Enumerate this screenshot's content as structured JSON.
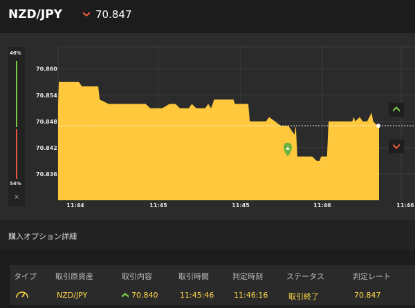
{
  "header": {
    "pair": "NZD/JPY",
    "rate": "70.847",
    "direction_icon": "down-arrow-icon",
    "direction_color": "#e2583e"
  },
  "ratio": {
    "high": "46%",
    "low": "54%",
    "close_label": "×",
    "high_color": "#7ac943",
    "low_color": "#e2583e"
  },
  "chart_data": {
    "type": "area",
    "color": "#ffc83d",
    "ylim": [
      70.83,
      70.865
    ],
    "y_ticks": [
      "70.860",
      "70.854",
      "70.848",
      "70.842",
      "70.836"
    ],
    "x_ticks": [
      "11:44",
      "11:45",
      "11:45",
      "11:46",
      "11:46"
    ],
    "current_rate": 70.847,
    "entry_rate": 70.84,
    "points": [
      [
        0,
        70.852
      ],
      [
        1,
        70.857
      ],
      [
        28,
        70.857
      ],
      [
        32,
        70.856
      ],
      [
        48,
        70.856
      ],
      [
        54,
        70.856
      ],
      [
        56,
        70.853
      ],
      [
        68,
        70.852
      ],
      [
        118,
        70.852
      ],
      [
        124,
        70.851
      ],
      [
        140,
        70.851
      ],
      [
        150,
        70.852
      ],
      [
        158,
        70.852
      ],
      [
        164,
        70.851
      ],
      [
        176,
        70.851
      ],
      [
        180,
        70.852
      ],
      [
        186,
        70.851
      ],
      [
        198,
        70.851
      ],
      [
        202,
        70.852
      ],
      [
        206,
        70.851
      ],
      [
        210,
        70.853
      ],
      [
        236,
        70.853
      ],
      [
        238,
        70.852
      ],
      [
        256,
        70.852
      ],
      [
        258,
        70.848
      ],
      [
        280,
        70.848
      ],
      [
        284,
        70.849
      ],
      [
        292,
        70.848
      ],
      [
        300,
        70.847
      ],
      [
        310,
        70.847
      ],
      [
        318,
        70.845
      ],
      [
        320,
        70.847
      ],
      [
        322,
        70.84
      ],
      [
        336,
        70.84
      ],
      [
        342,
        70.84
      ],
      [
        348,
        70.839
      ],
      [
        352,
        70.839
      ],
      [
        354,
        70.84
      ],
      [
        362,
        70.84
      ],
      [
        364,
        70.848
      ],
      [
        396,
        70.848
      ],
      [
        398,
        70.849
      ],
      [
        400,
        70.848
      ],
      [
        406,
        70.849
      ],
      [
        410,
        70.848
      ],
      [
        416,
        70.848
      ],
      [
        422,
        70.85
      ],
      [
        424,
        70.848
      ],
      [
        430,
        70.847
      ],
      [
        432,
        70.847
      ]
    ],
    "buttons": {
      "up_icon": "up-arrow-icon",
      "down_icon": "down-arrow-icon",
      "up_color": "#7ac943",
      "down_color": "#e2583e"
    }
  },
  "details": {
    "title": "購入オプション詳細",
    "columns": [
      "タイプ",
      "取引原資産",
      "取引内容",
      "取引時間",
      "判定時刻",
      "ステータス",
      "判定レート"
    ],
    "row": {
      "type_icon": "gauge-icon",
      "asset": "NZD/JPY",
      "direction_icon": "up-arrow-icon",
      "content": "70.840",
      "trade_time": "11:45:46",
      "judge_time": "11:46:16",
      "status": "取引終了",
      "judge_rate": "70.847"
    }
  }
}
